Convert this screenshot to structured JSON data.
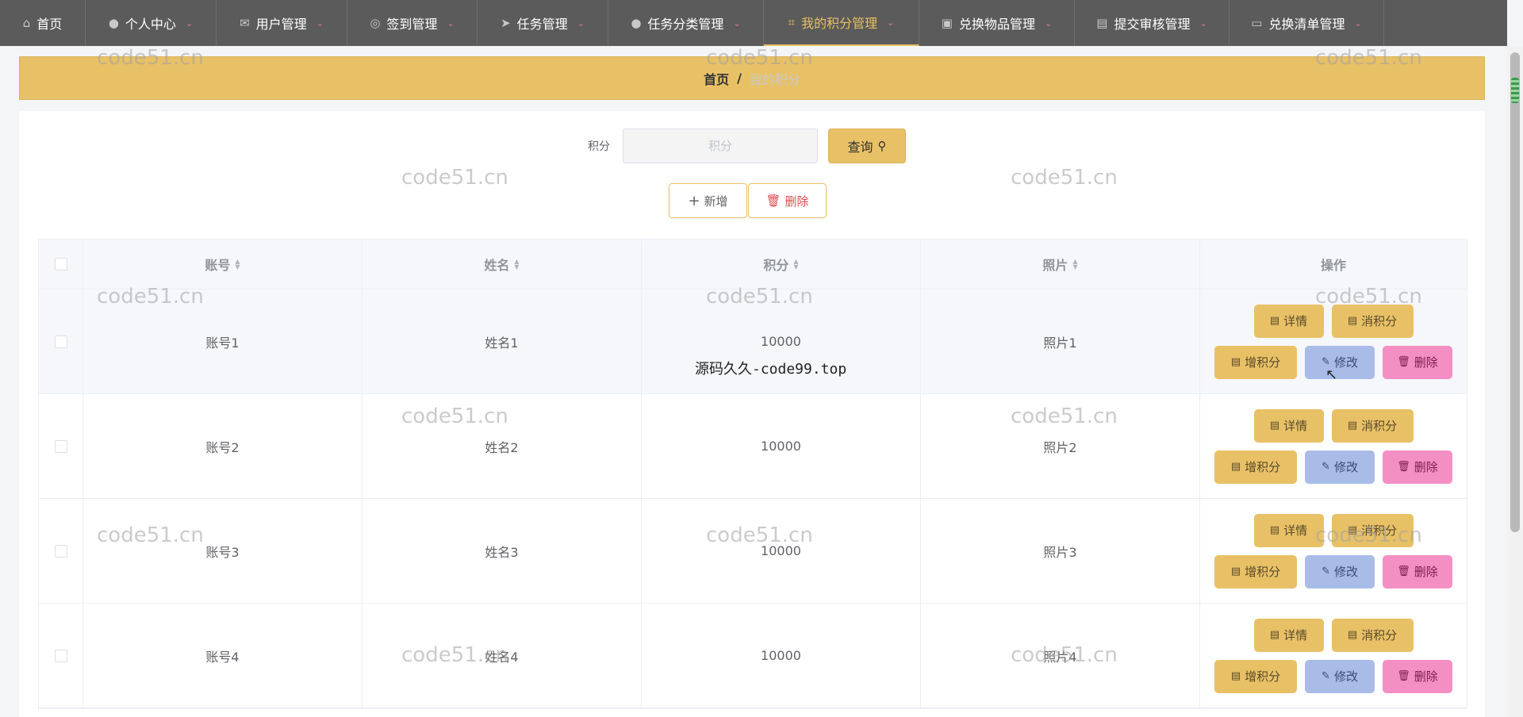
{
  "nav": [
    {
      "label": "首页",
      "icon": "home-icon",
      "glyph": "⌂",
      "active": false
    },
    {
      "label": "个人中心",
      "icon": "user-icon",
      "glyph": "●",
      "active": false
    },
    {
      "label": "用户管理",
      "icon": "mail-icon",
      "glyph": "✉",
      "active": false
    },
    {
      "label": "签到管理",
      "icon": "compass-icon",
      "glyph": "◎",
      "active": false
    },
    {
      "label": "任务管理",
      "icon": "send-icon",
      "glyph": "➤",
      "active": false
    },
    {
      "label": "任务分类管理",
      "icon": "user-icon",
      "glyph": "●",
      "active": false
    },
    {
      "label": "我的积分管理",
      "icon": "crop-icon",
      "glyph": "⌗",
      "active": true
    },
    {
      "label": "兑换物品管理",
      "icon": "suitcase-icon",
      "glyph": "▣",
      "active": false
    },
    {
      "label": "提交审核管理",
      "icon": "clipboard-icon",
      "glyph": "▤",
      "active": false
    },
    {
      "label": "兑换清单管理",
      "icon": "monitor-icon",
      "glyph": "▭",
      "active": false
    }
  ],
  "breadcrumb": {
    "home": "首页",
    "sep": "/",
    "current": "我的积分"
  },
  "search": {
    "label": "积分",
    "placeholder": "积分",
    "query_button": "查询"
  },
  "actions": {
    "add": "新增",
    "delete": "删除"
  },
  "table": {
    "columns": [
      "账号",
      "姓名",
      "积分",
      "照片",
      "操作"
    ],
    "rows": [
      {
        "account": "账号1",
        "name": "姓名1",
        "points": "10000",
        "photo": "照片1"
      },
      {
        "account": "账号2",
        "name": "姓名2",
        "points": "10000",
        "photo": "照片2"
      },
      {
        "account": "账号3",
        "name": "姓名3",
        "points": "10000",
        "photo": "照片3"
      },
      {
        "account": "账号4",
        "name": "姓名4",
        "points": "10000",
        "photo": "照片4"
      }
    ],
    "row_buttons": {
      "detail": "详情",
      "consume": "消积分",
      "add_points": "增积分",
      "edit": "修改",
      "remove": "删除"
    }
  },
  "watermark": "code51.cn",
  "overlay_text": "源码久久-code99.top",
  "colors": {
    "accent": "#e8c167",
    "nav_bg": "#5b5b5b",
    "edit": "#a9bce8",
    "remove": "#f48fc4"
  }
}
